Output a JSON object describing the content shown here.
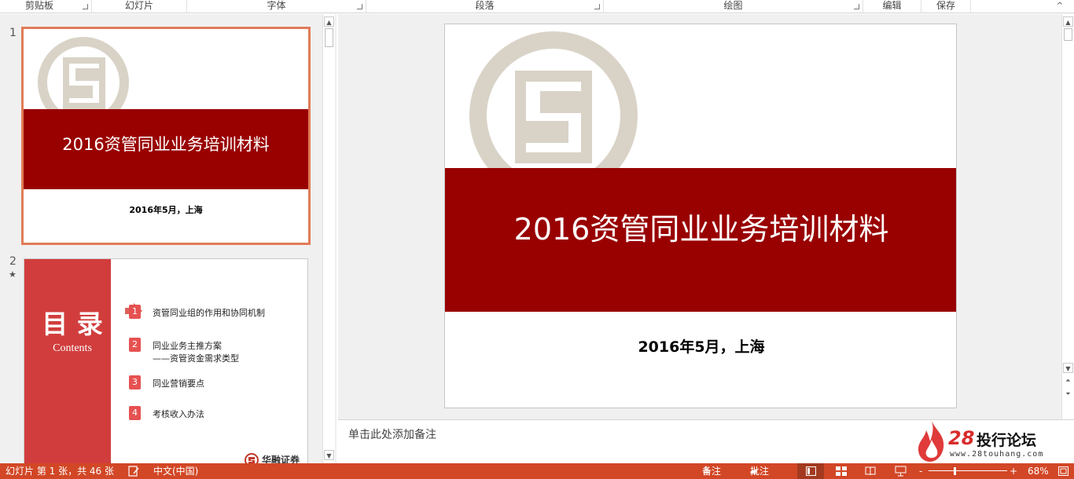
{
  "ribbon": {
    "groups": [
      "剪贴板",
      "幻灯片",
      "字体",
      "段落",
      "绘图",
      "编辑",
      "保存"
    ],
    "collapse_glyph": "^"
  },
  "thumbnails": [
    {
      "number": "1",
      "title": "2016资管同业业务培训材料",
      "subtitle": "2016年5月，上海"
    },
    {
      "number": "2",
      "star": "★",
      "heading": "目 录",
      "heading_en": "Contents",
      "items": [
        {
          "num": "1",
          "text": "资管同业组的作用和协同机制"
        },
        {
          "num": "2",
          "text": "同业业务主推方案",
          "text2": "——资管资金需求类型"
        },
        {
          "num": "3",
          "text": "同业营销要点"
        },
        {
          "num": "4",
          "text": "考核收入办法"
        }
      ],
      "brand": "华融证券"
    }
  ],
  "slide": {
    "title": "2016资管同业业务培训材料",
    "subtitle": "2016年5月，上海"
  },
  "notes": {
    "placeholder": "单击此处添加备注"
  },
  "watermark": {
    "number": "28",
    "name": "投行论坛",
    "url": "www.28touhang.com"
  },
  "status": {
    "slide_info": "幻灯片 第 1 张，共 46 张",
    "language": "中文(中国)",
    "notes_label": "备注",
    "comments_label": "批注",
    "zoom_minus": "-",
    "zoom_plus": "+",
    "zoom_percent": "68%",
    "zoom_fraction": 0.68
  },
  "colors": {
    "accent": "#d24726",
    "title_bar": "#990000",
    "logo": "#d9d3c7",
    "toc_red": "#d13d3d"
  }
}
